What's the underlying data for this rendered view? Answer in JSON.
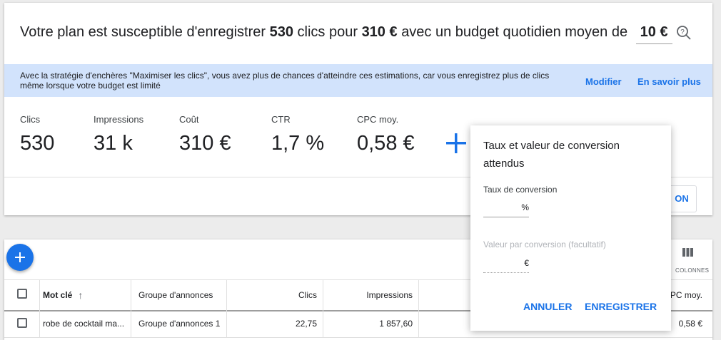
{
  "headline": {
    "prefix": "Votre plan est susceptible d'enregistrer",
    "clicks": "530",
    "middle": "clics pour",
    "cost": "310 €",
    "suffix": "avec un budget quotidien moyen de",
    "budget": "10 €"
  },
  "banner": {
    "text": "Avec la stratégie d'enchères \"Maximiser les clics\", vous avez plus de chances d'atteindre ces estimations, car vous enregistrez plus de clics même lorsque votre budget est limité",
    "modify": "Modifier",
    "learn_more": "En savoir plus"
  },
  "metrics": [
    {
      "label": "Clics",
      "value": "530"
    },
    {
      "label": "Impressions",
      "value": "31 k"
    },
    {
      "label": "Coût",
      "value": "310 €"
    },
    {
      "label": "CTR",
      "value": "1,7 %"
    },
    {
      "label": "CPC moy.",
      "value": "0,58 €"
    }
  ],
  "partial_button": "ON",
  "columns_label": "COLONNES",
  "table": {
    "headers": [
      "Mot clé",
      "Groupe d'annonces",
      "Clics",
      "Impressions",
      "PC moy."
    ],
    "row": [
      "robe de cocktail ma...",
      "Groupe d'annonces 1",
      "22,75",
      "1 857,60",
      "0,58 €"
    ]
  },
  "popup": {
    "title": "Taux et valeur de conversion attendus",
    "rate_label": "Taux de conversion",
    "rate_unit": "%",
    "value_label": "Valeur par conversion (facultatif)",
    "value_unit": "€",
    "cancel": "ANNULER",
    "save": "ENREGISTRER"
  },
  "colors": {
    "accent": "#1a73e8",
    "banner_bg": "#d2e3fc"
  }
}
